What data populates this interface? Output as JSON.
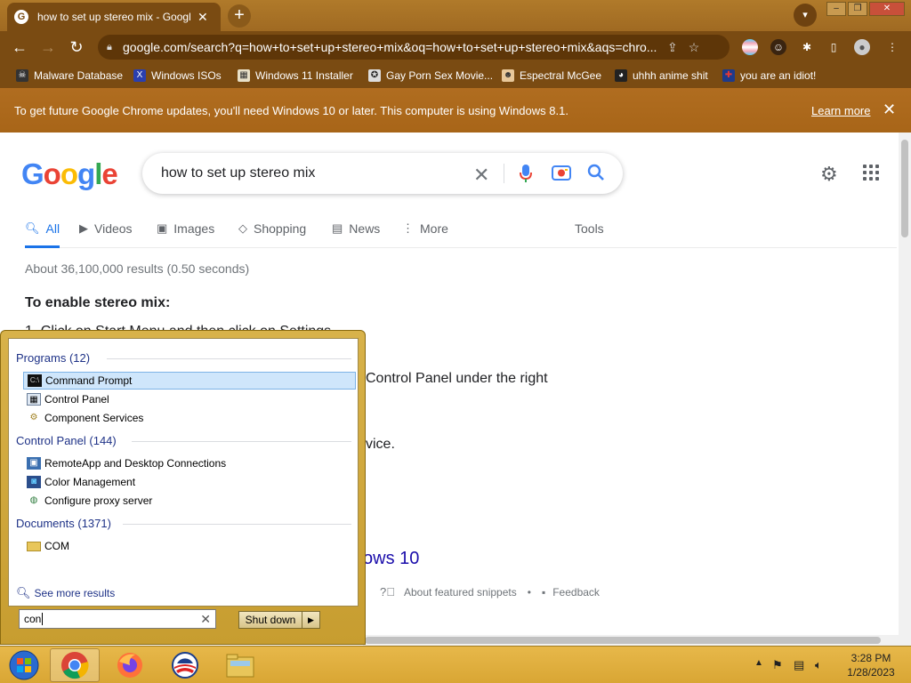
{
  "browser": {
    "tab_title": "how to set up stereo mix - Google",
    "tab_favicon": "G",
    "url": "google.com/search?q=how+to+set+up+stereo+mix&oq=how+to+set+up+stereo+mix&aqs=chro...",
    "bookmarks": [
      {
        "label": "Malware Database",
        "icon": "skull-icon"
      },
      {
        "label": "Windows ISOs",
        "icon": "x-icon"
      },
      {
        "label": "Windows 11 Installer",
        "icon": "image-icon"
      },
      {
        "label": "Gay Porn Sex Movie...",
        "icon": "badge-icon"
      },
      {
        "label": "Espectral McGee",
        "icon": "face-icon"
      },
      {
        "label": "uhhh anime shit",
        "icon": "anime-icon"
      },
      {
        "label": "you are an idiot!",
        "icon": "flag-icon"
      }
    ],
    "infobar": {
      "text": "To get future Google Chrome updates, you'll need Windows 10 or later. This computer is using Windows 8.1.",
      "learn_more": "Learn more"
    }
  },
  "google": {
    "logo": "Google",
    "query": "how to set up stereo mix",
    "tabs": [
      {
        "label": "All",
        "icon": "search-icon"
      },
      {
        "label": "Videos",
        "icon": "play-icon"
      },
      {
        "label": "Images",
        "icon": "image-icon"
      },
      {
        "label": "Shopping",
        "icon": "tag-icon"
      },
      {
        "label": "News",
        "icon": "news-icon"
      },
      {
        "label": "More",
        "icon": "more-vert-icon"
      }
    ],
    "tools": "Tools",
    "stats": "About 36,100,000 results (0.50 seconds)",
    "snippet_heading": "To enable stereo mix:",
    "snippet_line1": "1. Click on Start Menu and then click on Settings.",
    "snippet_line2": "Control Panel under the right",
    "snippet_line3": "vice.",
    "result_link": "ows 10",
    "about_snippets": "About featured snippets",
    "feedback": "Feedback",
    "separator": "•"
  },
  "startmenu": {
    "programs_header": "Programs (12)",
    "programs": [
      "Command Prompt",
      "Control Panel",
      "Component Services"
    ],
    "control_panel_header": "Control Panel (144)",
    "control_panel": [
      "RemoteApp and Desktop Connections",
      "Color Management",
      "Configure proxy server"
    ],
    "documents_header": "Documents (1371)",
    "documents": [
      "COM"
    ],
    "see_more": "See more results",
    "search_value": "con",
    "shutdown_label": "Shut down"
  },
  "taskbar": {
    "time": "3:28 PM",
    "date": "1/28/2023"
  }
}
